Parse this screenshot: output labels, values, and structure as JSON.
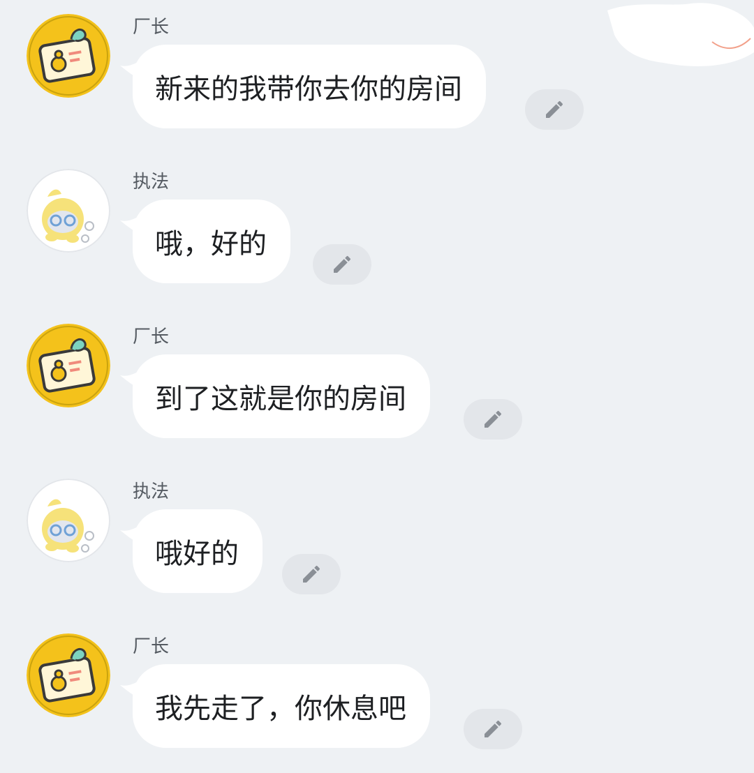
{
  "messages": [
    {
      "sender": "厂长",
      "text": "新来的我带你去你的房间",
      "avatar": "badge-avatar-icon"
    },
    {
      "sender": "执法",
      "text": "哦，好的",
      "avatar": "chick-avatar-icon"
    },
    {
      "sender": "厂长",
      "text": "到了这就是你的房间",
      "avatar": "badge-avatar-icon"
    },
    {
      "sender": "执法",
      "text": "哦好的",
      "avatar": "chick-avatar-icon"
    },
    {
      "sender": "厂长",
      "text": "我先走了，你休息吧",
      "avatar": "badge-avatar-icon"
    }
  ],
  "colors": {
    "background": "#eef1f4",
    "bubble": "#ffffff",
    "badge_avatar": "#f4c21b",
    "edit_button": "#e3e6ea"
  }
}
